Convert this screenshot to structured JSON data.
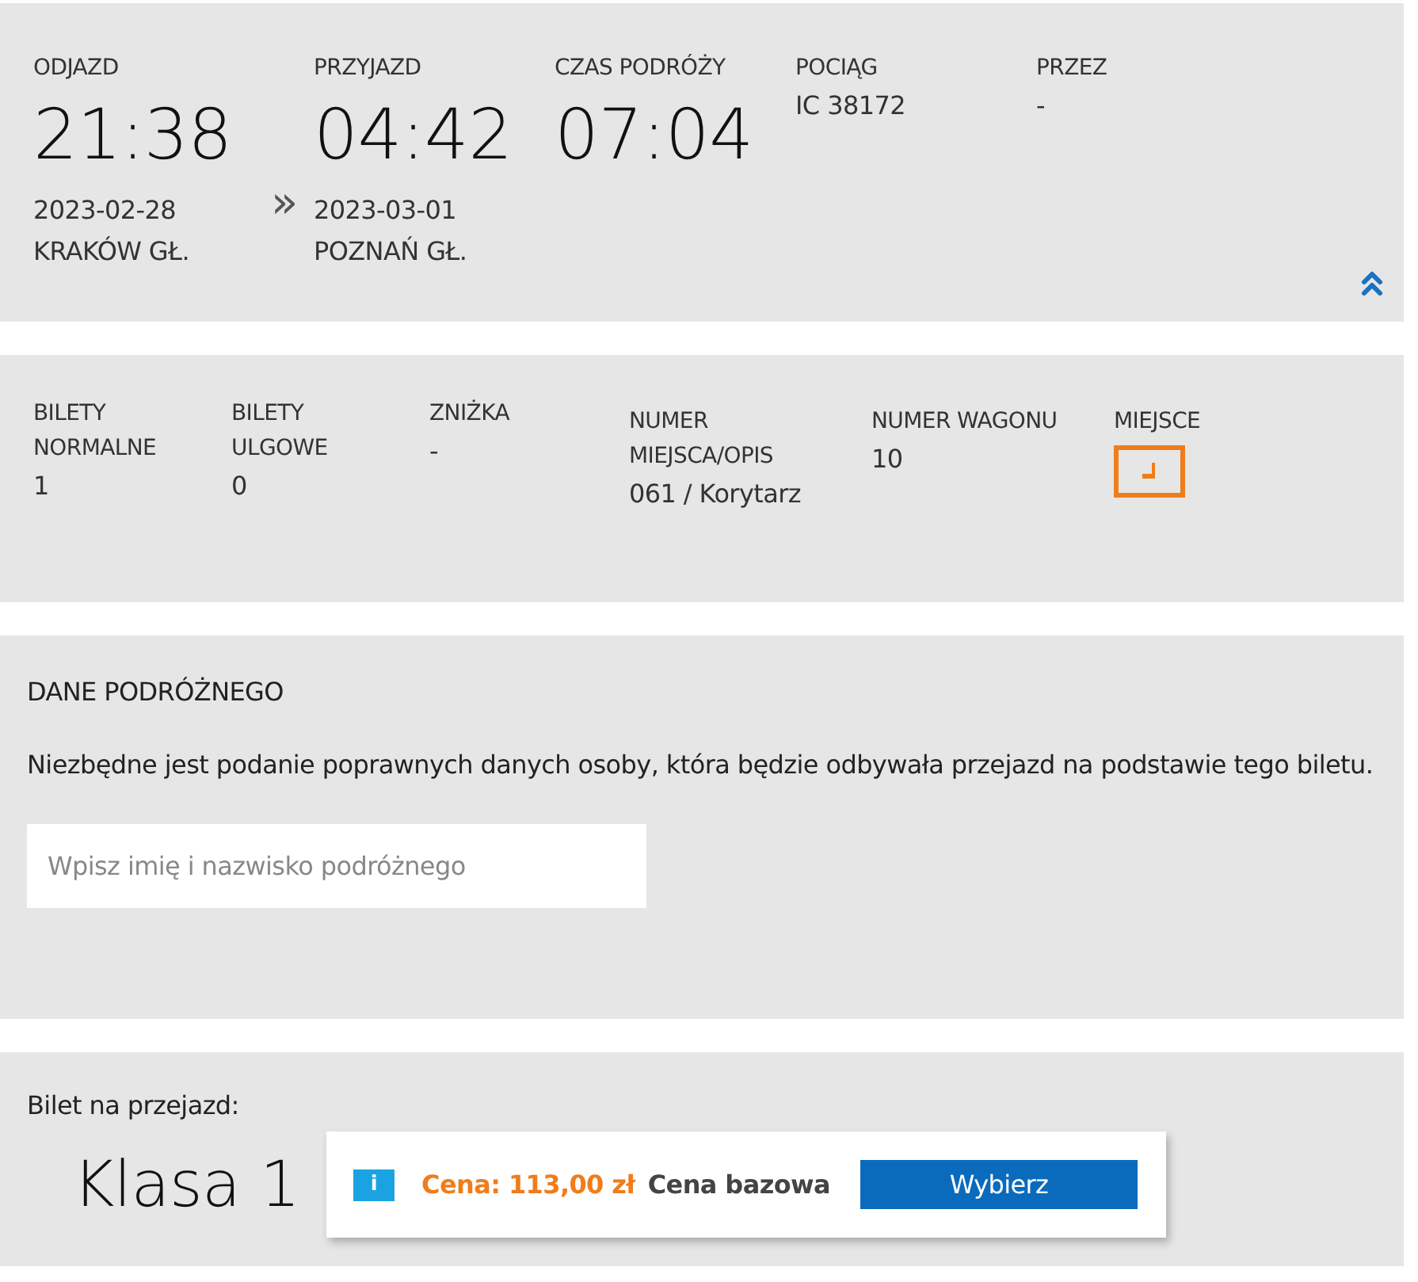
{
  "journey": {
    "departure": {
      "label": "ODJAZD",
      "time": "21:38",
      "date": "2023-02-28",
      "station": "KRAKÓW GŁ."
    },
    "separator": "»",
    "arrival": {
      "label": "PRZYJAZD",
      "time": "04:42",
      "date": "2023-03-01",
      "station": "POZNAŃ GŁ."
    },
    "duration": {
      "label": "CZAS PODRÓŻY",
      "time": "07:04"
    },
    "train": {
      "label": "POCIĄG",
      "value": "IC 38172"
    },
    "via": {
      "label": "PRZEZ",
      "value": "-"
    }
  },
  "tickets": {
    "fields": [
      {
        "label": "BILETY NORMALNE",
        "value": "1"
      },
      {
        "label": "BILETY ULGOWE",
        "value": "0"
      },
      {
        "label": "ZNIŻKA",
        "value": "-"
      },
      {
        "label": "NUMER MIEJSCA/OPIS",
        "value": "061 / Korytarz"
      },
      {
        "label": "NUMER WAGONU",
        "value": "10"
      }
    ],
    "seat_label": "MIEJSCE"
  },
  "passenger": {
    "title": "DANE PODRÓŻNEGO",
    "note": "Niezbędne jest podanie poprawnych danych osoby, która będzie odbywała przejazd na podstawie tego biletu.",
    "placeholder": "Wpisz imię i nazwisko podróżnego"
  },
  "offer": {
    "heading": "Bilet na przejazd:",
    "class": "Klasa 1",
    "info_glyph": "i",
    "price": "Cena: 113,00 zł",
    "price_type": "Cena bazowa",
    "button": "Wybierz"
  }
}
